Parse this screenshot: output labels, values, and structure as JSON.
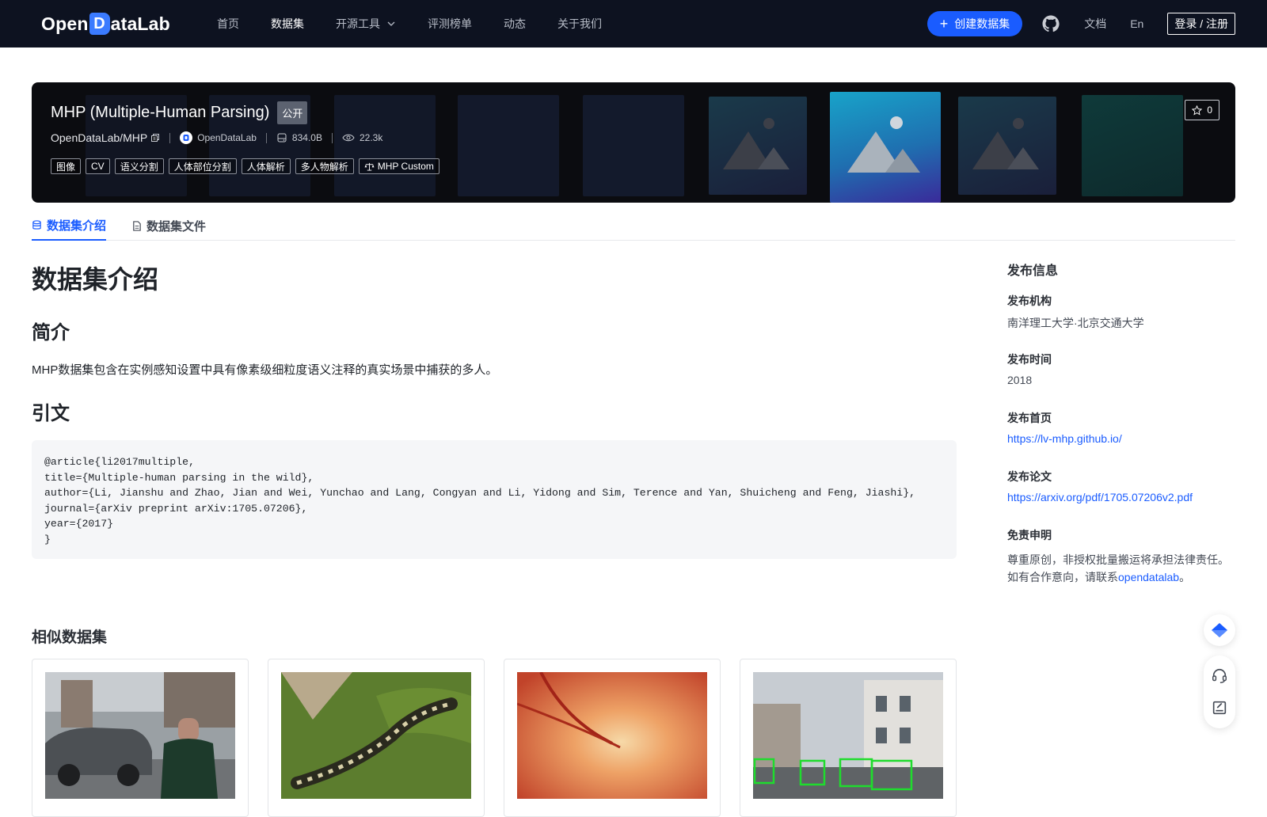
{
  "nav": {
    "logo_pre": "Open",
    "logo_d": "D",
    "logo_post": "ataLab",
    "links": [
      {
        "label": "首页",
        "active": false
      },
      {
        "label": "数据集",
        "active": true
      },
      {
        "label": "开源工具",
        "active": false,
        "dropdown": true
      },
      {
        "label": "评测榜单",
        "active": false
      },
      {
        "label": "动态",
        "active": false
      },
      {
        "label": "关于我们",
        "active": false
      }
    ],
    "create_label": "创建数据集",
    "doc_label": "文档",
    "lang_label": "En",
    "login_label": "登录 / 注册"
  },
  "dataset": {
    "title": "MHP (Multiple-Human Parsing)",
    "visibility": "公开",
    "path": "OpenDataLab/MHP",
    "publisher": "OpenDataLab",
    "size": "834.0B",
    "views": "22.3k",
    "tags": [
      "图像",
      "CV",
      "语义分割",
      "人体部位分割",
      "人体解析",
      "多人物解析"
    ],
    "license": "MHP Custom",
    "stars": "0"
  },
  "tabs": {
    "intro": "数据集介绍",
    "files": "数据集文件"
  },
  "content": {
    "h1": "数据集介绍",
    "intro_heading": "简介",
    "intro_text": "MHP数据集包含在实例感知设置中具有像素级细粒度语义注释的真实场景中捕获的多人。",
    "cite_heading": "引文",
    "citation": "@article{li2017multiple,\ntitle={Multiple-human parsing in the wild},\nauthor={Li, Jianshu and Zhao, Jian and Wei, Yunchao and Lang, Congyan and Li, Yidong and Sim, Terence and Yan, Shuicheng and Feng, Jiashi},\njournal={arXiv preprint arXiv:1705.07206},\nyear={2017}\n}",
    "similar_heading": "相似数据集"
  },
  "sidebar": {
    "title": "发布信息",
    "org_label": "发布机构",
    "org_value": "南洋理工大学·北京交通大学",
    "time_label": "发布时间",
    "time_value": "2018",
    "home_label": "发布首页",
    "home_value": "https://lv-mhp.github.io/",
    "paper_label": "发布论文",
    "paper_value": "https://arxiv.org/pdf/1705.07206v2.pdf",
    "disclaimer_label": "免责申明",
    "disclaimer_line1": "尊重原创，非授权批量搬运将承担法律责任。",
    "disclaimer_line2_pre": "如有合作意向，请联系",
    "disclaimer_link": "opendatalab",
    "disclaimer_end": "。"
  },
  "colors": {
    "nav_bg": "#0d1220",
    "accent": "#1a5cff",
    "banner_bg": "#0b0c10"
  }
}
